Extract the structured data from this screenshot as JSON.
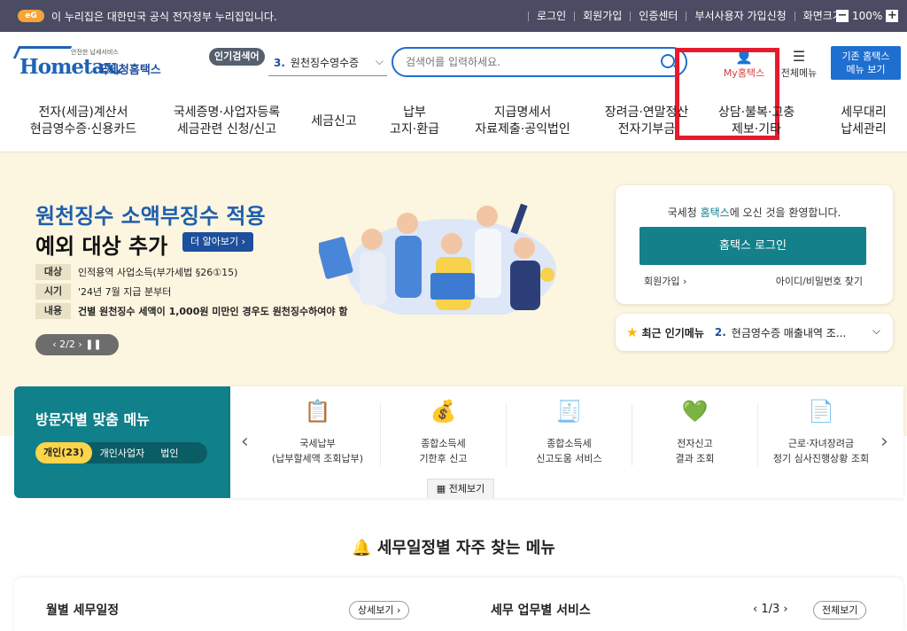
{
  "topbar": {
    "egov_logo": "eG",
    "notice": "이 누리집은 대한민국 공식 전자정부 누리집입니다.",
    "links": [
      "로그인",
      "회원가입",
      "인증센터",
      "부서사용자 가입신청",
      "화면크기"
    ],
    "zoom_minus": "−",
    "zoom_value": "100%",
    "zoom_plus": "+"
  },
  "header": {
    "logo_small": "안전한 납세서비스",
    "logo_brand": "Hometax.",
    "logo_kname": "국세청홈택스",
    "popular_badge": "인기검색어",
    "popular_rank": "3.",
    "popular_term": "원천징수영수증",
    "search_placeholder": "검색어를 입력하세요.",
    "myhome_label": "My홈택스",
    "allmenu_label": "전체메뉴",
    "old_btn_line1": "기존 홈택스",
    "old_btn_line2": "메뉴 보기"
  },
  "gnb": [
    {
      "l1": "전자(세금)계산서",
      "l2": "현금영수증·신용카드"
    },
    {
      "l1": "국세증명·사업자등록",
      "l2": "세금관련 신청/신고"
    },
    {
      "l1": "세금신고",
      "l2": ""
    },
    {
      "l1": "납부",
      "l2": "고지·환급"
    },
    {
      "l1": "지급명세서",
      "l2": "자료제출·공익법인"
    },
    {
      "l1": "장려금·연말정산",
      "l2": "전자기부금"
    },
    {
      "l1": "상담·불복·고충",
      "l2": "제보·기타"
    },
    {
      "l1": "세무대리",
      "l2": "납세관리"
    }
  ],
  "hero": {
    "title1": "원천징수 소액부징수 적용",
    "title2": "예외 대상 추가",
    "more_btn": "더 알아보기 ›",
    "rows": [
      {
        "tag": "대상",
        "text": "인적용역 사업소득(부가세법 §26①15)"
      },
      {
        "tag": "시기",
        "text": "'24년 7월 지급 분부터"
      },
      {
        "tag": "내용",
        "text": "건별 원천징수 세액이 1,000원 미만인 경우도 원천징수하여야 함"
      }
    ],
    "pager": "‹  2/2  ›   ❚❚"
  },
  "login": {
    "welcome_pre": "국세청 ",
    "welcome_brand": "홈택스",
    "welcome_post": "에 오신 것을 환영합니다.",
    "login_btn": "홈택스 로그인",
    "join": "회원가입 ›",
    "find": "아이디/비밀번호 찾기"
  },
  "recent": {
    "label": "최근 인기메뉴",
    "rank": "2.",
    "item": "현금영수증 매출내역 조..."
  },
  "visitor": {
    "title": "방문자별 맞춤 메뉴",
    "tabs": [
      "개인(23)",
      "개인사업자",
      "법인"
    ]
  },
  "services": [
    {
      "icon": "📋",
      "l1": "국세납부",
      "l2": "(납부할세액 조회납부)"
    },
    {
      "icon": "💰",
      "l1": "종합소득세",
      "l2": "기한후 신고"
    },
    {
      "icon": "🧾",
      "l1": "종합소득세",
      "l2": "신고도움 서비스"
    },
    {
      "icon": "💚",
      "l1": "전자신고",
      "l2": "결과 조회"
    },
    {
      "icon": "📄",
      "l1": "근로·자녀장려금",
      "l2": "정기 심사진행상황 조회"
    }
  ],
  "services_allview": "전체보기",
  "schedule": {
    "section_title": "세무일정별 자주 찾는 메뉴",
    "monthly": "월별 세무일정",
    "detail_btn": "상세보기 ›",
    "task": "세무 업무별 서비스",
    "page": "‹  1/3  ›",
    "allview": "전체보기"
  }
}
